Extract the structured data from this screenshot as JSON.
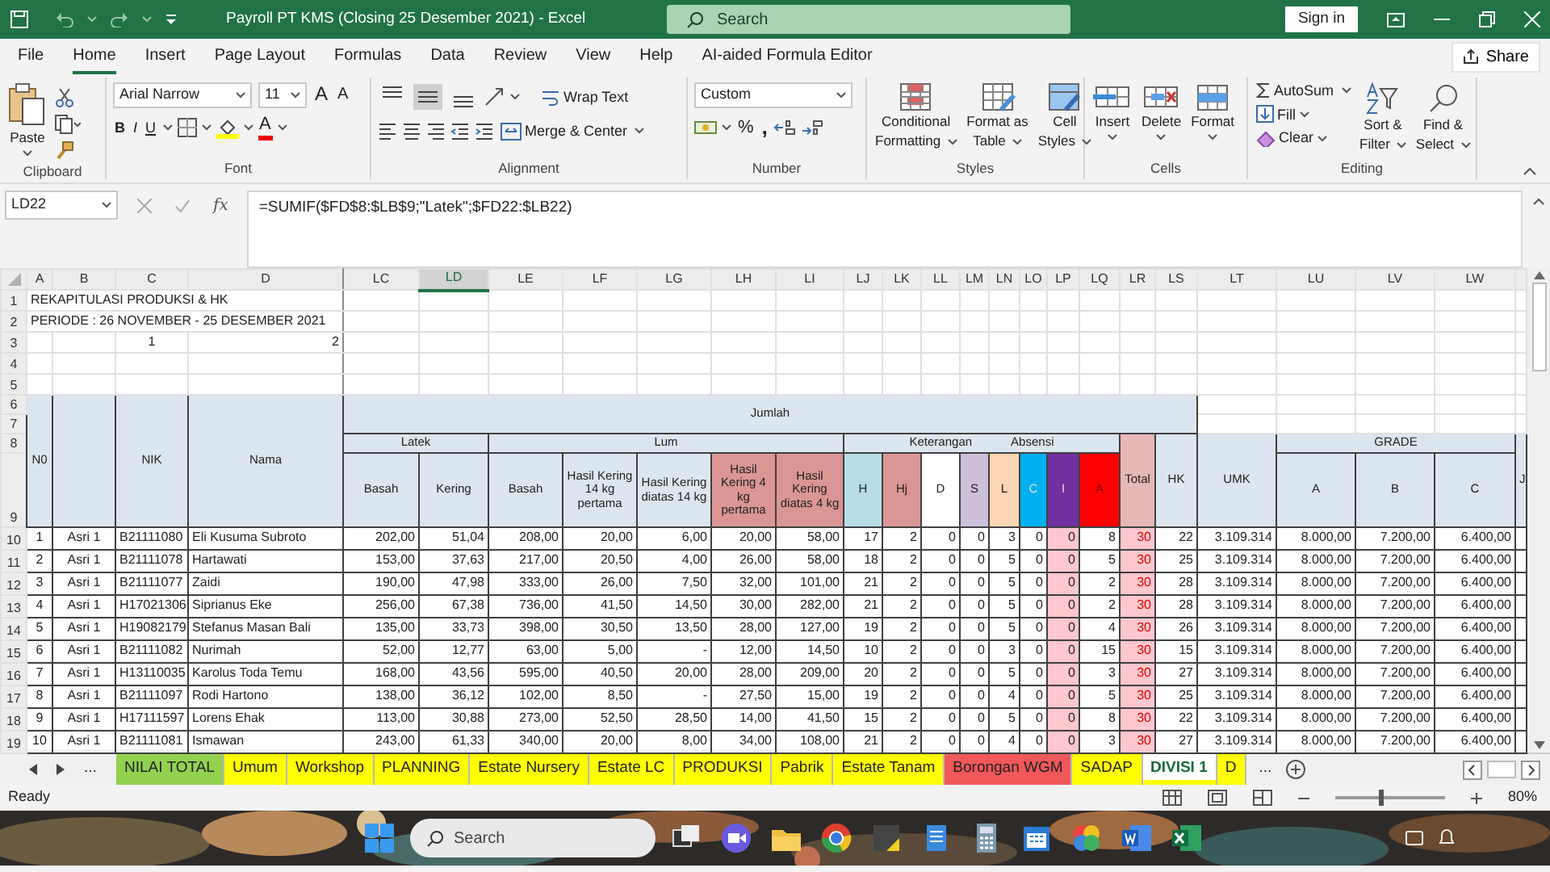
{
  "title_bar": {
    "title": "Payroll PT KMS (Closing 25 Desember 2021)  -  Excel",
    "search": "Search",
    "sign_in": "Sign in"
  },
  "menu_tabs": [
    {
      "label": "File",
      "selected": false
    },
    {
      "label": "Home",
      "selected": true
    },
    {
      "label": "Insert",
      "selected": false
    },
    {
      "label": "Page Layout",
      "selected": false
    },
    {
      "label": "Formulas",
      "selected": false
    },
    {
      "label": "Data",
      "selected": false
    },
    {
      "label": "Review",
      "selected": false
    },
    {
      "label": "View",
      "selected": false
    },
    {
      "label": "Help",
      "selected": false
    },
    {
      "label": "AI-aided Formula Editor",
      "selected": false
    }
  ],
  "share": "Share",
  "ribbon": {
    "clipboard": {
      "paste": "Paste",
      "label": "Clipboard"
    },
    "font": {
      "name": "Arial Narrow",
      "size": "11",
      "grow": "A",
      "shrink": "A",
      "bold": "B",
      "italic": "I",
      "underline": "U",
      "color_letter": "A",
      "label": "Font"
    },
    "alignment": {
      "vertical_align": [
        {
          "selected": false
        },
        {
          "selected": true
        },
        {
          "selected": false
        }
      ],
      "wrap_text": "Wrap Text",
      "merge_center": "Merge & Center",
      "label": "Alignment"
    },
    "number": {
      "format": "Custom",
      "percent": "%",
      "comma": ",",
      "label": "Number"
    },
    "styles": {
      "buttons": [
        {
          "lines": [
            "Conditional",
            "Formatting"
          ]
        },
        {
          "lines": [
            "Format as",
            "Table"
          ]
        },
        {
          "lines": [
            "Cell",
            "Styles"
          ]
        }
      ],
      "label": "Styles"
    },
    "cells": {
      "buttons": [
        "Insert",
        "Delete",
        "Format"
      ],
      "label": "Cells"
    },
    "editing": {
      "autosum": "AutoSum",
      "fill": "Fill",
      "clear": "Clear",
      "sort_filter": [
        "Sort &",
        "Filter"
      ],
      "find_select": [
        "Find &",
        "Select"
      ],
      "label": "Editing"
    }
  },
  "formula_bar": {
    "name_box": "LD22",
    "fx": "fx",
    "formula": "=SUMIF($FD$8:$LB$9;\"Latek\";$FD22:$LB22)"
  },
  "sheet": {
    "column_headers": [
      {
        "label": "A",
        "selected": false
      },
      {
        "label": "B",
        "selected": false
      },
      {
        "label": "C",
        "selected": false
      },
      {
        "label": "D",
        "selected": false
      },
      {
        "label": "LC",
        "selected": false
      },
      {
        "label": "LD",
        "selected": true
      },
      {
        "label": "LE",
        "selected": false
      },
      {
        "label": "LF",
        "selected": false
      },
      {
        "label": "LG",
        "selected": false
      },
      {
        "label": "LH",
        "selected": false
      },
      {
        "label": "LI",
        "selected": false
      },
      {
        "label": "LJ",
        "selected": false
      },
      {
        "label": "LK",
        "selected": false
      },
      {
        "label": "LL",
        "selected": false
      },
      {
        "label": "LM",
        "selected": false
      },
      {
        "label": "LN",
        "selected": false
      },
      {
        "label": "LO",
        "selected": false
      },
      {
        "label": "LP",
        "selected": false
      },
      {
        "label": "LQ",
        "selected": false
      },
      {
        "label": "LR",
        "selected": false
      },
      {
        "label": "LS",
        "selected": false
      },
      {
        "label": "LT",
        "selected": false
      },
      {
        "label": "LU",
        "selected": false
      },
      {
        "label": "LV",
        "selected": false
      },
      {
        "label": "LW",
        "selected": false
      }
    ],
    "row_numbers": [
      "1",
      "2",
      "3",
      "4",
      "5",
      "6",
      "7",
      "8",
      "9",
      "10",
      "11",
      "12",
      "13",
      "14",
      "15",
      "16",
      "17",
      "18",
      "19"
    ],
    "title": "REKAPITULASI PRODUKSI & HK",
    "period": "PERIODE : 26 NOVEMBER - 25 DESEMBER 2021",
    "row3": [
      "1",
      "2"
    ],
    "header": {
      "no": "N0",
      "nik": "NIK",
      "nama": "Nama",
      "jumlah": "Jumlah",
      "latek": "Latek",
      "lum": "Lum",
      "keterangan": "Keterangan",
      "absensi": "Absensi",
      "total": "Total",
      "hk": "HK",
      "umk": "UMK",
      "grade": "GRADE",
      "cut_column": "J",
      "columns": [
        {
          "label": "Basah",
          "color": "#dce6f1",
          "shaded": false
        },
        {
          "label": "Kering",
          "color": "#dce6f1",
          "shaded": false
        },
        {
          "label": "Basah",
          "color": "#dce6f1",
          "shaded": false
        },
        {
          "label": "Hasil Kering 14 kg pertama",
          "color": "#dce6f1",
          "shaded": false
        },
        {
          "label": "Hasil Kering diatas 14 kg",
          "color": "#dce6f1",
          "shaded": false
        },
        {
          "label": "Hasil Kering 4 kg pertama",
          "color": "#da9694",
          "shaded": false
        },
        {
          "label": "Hasil Kering diatas 4 kg",
          "color": "#da9694",
          "shaded": false
        },
        {
          "label": "H",
          "color": "#b7dee8",
          "shaded": false
        },
        {
          "label": "Hj",
          "color": "#da9694",
          "shaded": false
        },
        {
          "label": "D",
          "color": "#ffffff",
          "shaded": false
        },
        {
          "label": "S",
          "color": "#ccc0da",
          "shaded": false
        },
        {
          "label": "L",
          "color": "#fcd5b4",
          "shaded": false
        },
        {
          "label": "C",
          "color": "#00b0f0",
          "shaded": false
        },
        {
          "label": "I",
          "color": "#7030a0",
          "shaded": true
        },
        {
          "label": "A",
          "color": "#ff0000",
          "shaded": false
        }
      ],
      "grade_columns": [
        "A",
        "B",
        "C"
      ]
    },
    "rows": [
      {
        "no": "1",
        "division": "Asri 1",
        "nik": "B21111080",
        "name": "Eli Kusuma Subroto",
        "values": [
          "202,00",
          "51,04",
          "208,00",
          "20,00",
          "6,00",
          "20,00",
          "58,00",
          "17",
          "2",
          "0",
          "0",
          "3",
          "0",
          "0",
          "8"
        ],
        "total": "30",
        "hk": "22",
        "umk": "3.109.314",
        "grades": [
          "8.000,00",
          "7.200,00",
          "6.400,00"
        ]
      },
      {
        "no": "2",
        "division": "Asri 1",
        "nik": "B21111078",
        "name": "Hartawati",
        "values": [
          "153,00",
          "37,63",
          "217,00",
          "20,50",
          "4,00",
          "26,00",
          "58,00",
          "18",
          "2",
          "0",
          "0",
          "5",
          "0",
          "0",
          "5"
        ],
        "total": "30",
        "hk": "25",
        "umk": "3.109.314",
        "grades": [
          "8.000,00",
          "7.200,00",
          "6.400,00"
        ]
      },
      {
        "no": "3",
        "division": "Asri 1",
        "nik": "B21111077",
        "name": "Zaidi",
        "values": [
          "190,00",
          "47,98",
          "333,00",
          "26,00",
          "7,50",
          "32,00",
          "101,00",
          "21",
          "2",
          "0",
          "0",
          "5",
          "0",
          "0",
          "2"
        ],
        "total": "30",
        "hk": "28",
        "umk": "3.109.314",
        "grades": [
          "8.000,00",
          "7.200,00",
          "6.400,00"
        ]
      },
      {
        "no": "4",
        "division": "Asri 1",
        "nik": "H17021306",
        "name": "Siprianus Eke",
        "values": [
          "256,00",
          "67,38",
          "736,00",
          "41,50",
          "14,50",
          "30,00",
          "282,00",
          "21",
          "2",
          "0",
          "0",
          "5",
          "0",
          "0",
          "2"
        ],
        "total": "30",
        "hk": "28",
        "umk": "3.109.314",
        "grades": [
          "8.000,00",
          "7.200,00",
          "6.400,00"
        ]
      },
      {
        "no": "5",
        "division": "Asri 1",
        "nik": "H19082179",
        "name": "Stefanus Masan Bali",
        "values": [
          "135,00",
          "33,73",
          "398,00",
          "30,50",
          "13,50",
          "28,00",
          "127,00",
          "19",
          "2",
          "0",
          "0",
          "5",
          "0",
          "0",
          "4"
        ],
        "total": "30",
        "hk": "26",
        "umk": "3.109.314",
        "grades": [
          "8.000,00",
          "7.200,00",
          "6.400,00"
        ]
      },
      {
        "no": "6",
        "division": "Asri 1",
        "nik": "B21111082",
        "name": "Nurimah",
        "values": [
          "52,00",
          "12,77",
          "63,00",
          "5,00",
          "-",
          "12,00",
          "14,50",
          "10",
          "2",
          "0",
          "0",
          "3",
          "0",
          "0",
          "15"
        ],
        "total": "30",
        "hk": "15",
        "umk": "3.109.314",
        "grades": [
          "8.000,00",
          "7.200,00",
          "6.400,00"
        ]
      },
      {
        "no": "7",
        "division": "Asri 1",
        "nik": "H13110035",
        "name": "Karolus Toda Temu",
        "values": [
          "168,00",
          "43,56",
          "595,00",
          "40,50",
          "20,00",
          "28,00",
          "209,00",
          "20",
          "2",
          "0",
          "0",
          "5",
          "0",
          "0",
          "3"
        ],
        "total": "30",
        "hk": "27",
        "umk": "3.109.314",
        "grades": [
          "8.000,00",
          "7.200,00",
          "6.400,00"
        ]
      },
      {
        "no": "8",
        "division": "Asri 1",
        "nik": "B21111097",
        "name": "Rodi Hartono",
        "values": [
          "138,00",
          "36,12",
          "102,00",
          "8,50",
          "-",
          "27,50",
          "15,00",
          "19",
          "2",
          "0",
          "0",
          "4",
          "0",
          "0",
          "5"
        ],
        "total": "30",
        "hk": "25",
        "umk": "3.109.314",
        "grades": [
          "8.000,00",
          "7.200,00",
          "6.400,00"
        ]
      },
      {
        "no": "9",
        "division": "Asri 1",
        "nik": "H17111597",
        "name": "Lorens Ehak",
        "values": [
          "113,00",
          "30,88",
          "273,00",
          "52,50",
          "28,50",
          "14,00",
          "41,50",
          "15",
          "2",
          "0",
          "0",
          "5",
          "0",
          "0",
          "8"
        ],
        "total": "30",
        "hk": "22",
        "umk": "3.109.314",
        "grades": [
          "8.000,00",
          "7.200,00",
          "6.400,00"
        ]
      },
      {
        "no": "10",
        "division": "Asri 1",
        "nik": "B21111081",
        "name": "Ismawan",
        "values": [
          "243,00",
          "61,33",
          "340,00",
          "20,00",
          "8,00",
          "34,00",
          "108,00",
          "21",
          "2",
          "0",
          "0",
          "4",
          "0",
          "0",
          "3"
        ],
        "total": "30",
        "hk": "27",
        "umk": "3.109.314",
        "grades": [
          "8.000,00",
          "7.200,00",
          "6.400,00"
        ]
      }
    ]
  },
  "tab_nav": {
    "more_left": "...",
    "more_right": "..."
  },
  "sheet_tabs": [
    {
      "label": "NILAI TOTAL",
      "color": "#92d050",
      "selected": false
    },
    {
      "label": "Umum",
      "color": "#ffff00",
      "selected": false
    },
    {
      "label": "Workshop",
      "color": "#ffff00",
      "selected": false
    },
    {
      "label": "PLANNING",
      "color": "#ffff00",
      "selected": false
    },
    {
      "label": "Estate Nursery",
      "color": "#ffff00",
      "selected": false
    },
    {
      "label": "Estate LC",
      "color": "#ffff00",
      "selected": false
    },
    {
      "label": "PRODUKSI",
      "color": "#ffff00",
      "selected": false
    },
    {
      "label": "Pabrik",
      "color": "#ffff00",
      "selected": false
    },
    {
      "label": "Estate Tanam",
      "color": "#ffff00",
      "selected": false
    },
    {
      "label": "Borongan WGM",
      "color": "#f0585a",
      "selected": false
    },
    {
      "label": "SADAP",
      "color": "#ffff00",
      "selected": false
    },
    {
      "label": "DIVISI 1",
      "color": "#ffff00",
      "selected": true
    },
    {
      "label": "D",
      "color": "#ffff00",
      "selected": false
    }
  ],
  "status_bar": {
    "status": "Ready",
    "zoom": {
      "reading": "80%",
      "level": 0.4
    }
  },
  "taskbar": {
    "search": "Search"
  }
}
